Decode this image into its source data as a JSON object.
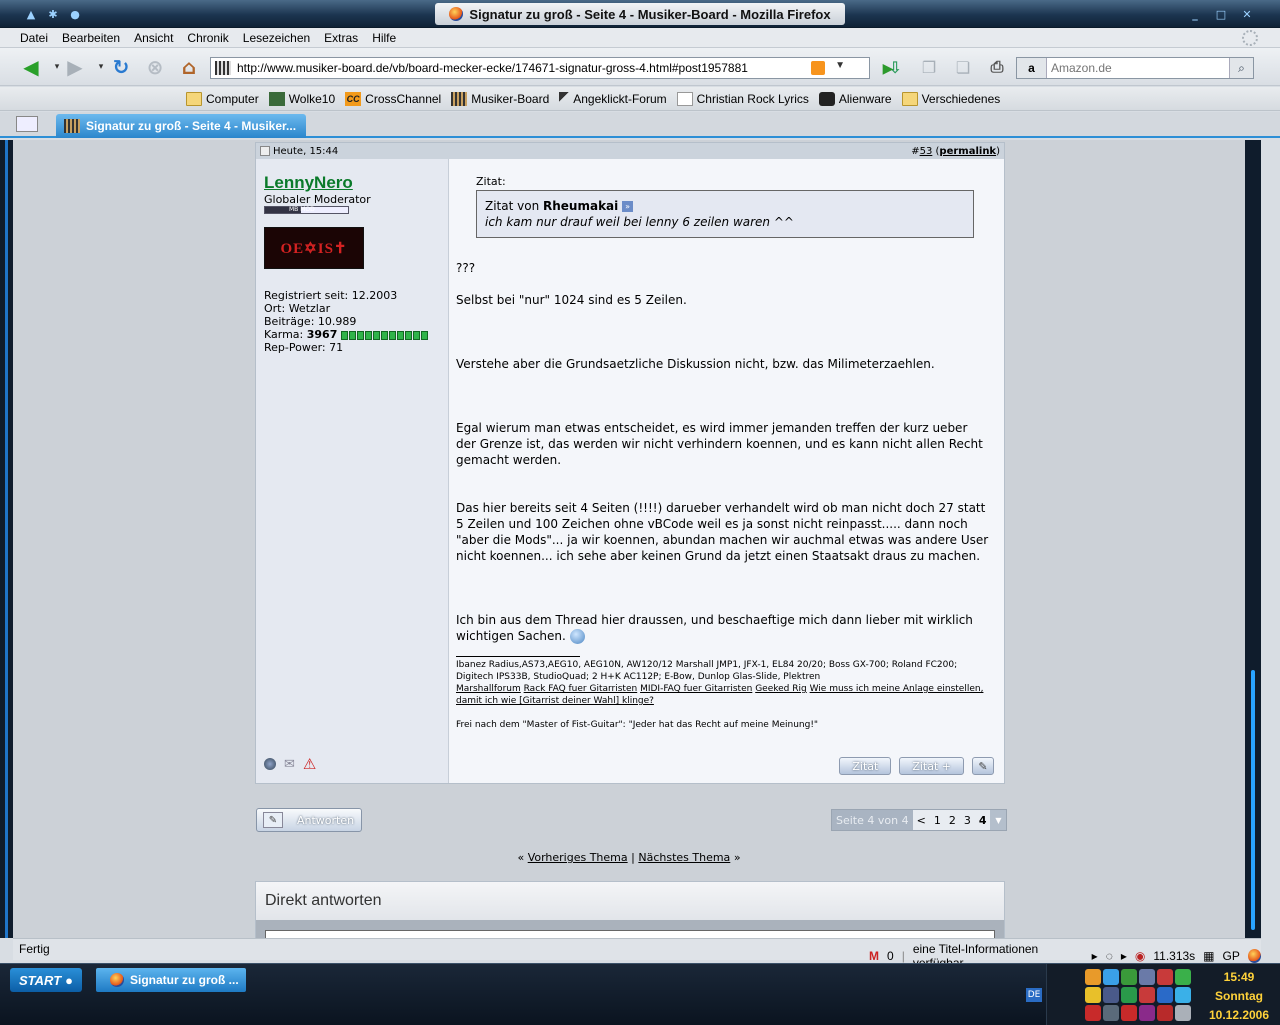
{
  "window": {
    "title": "Signatur zu groß - Seite 4 - Musiker-Board - Mozilla Firefox",
    "controls": [
      "_",
      "□",
      "✕"
    ]
  },
  "menu": [
    "Datei",
    "Bearbeiten",
    "Ansicht",
    "Chronik",
    "Lesezeichen",
    "Extras",
    "Hilfe"
  ],
  "nav": {
    "url": "http://www.musiker-board.de/vb/board-mecker-ecke/174671-signatur-gross-4.html#post1957881",
    "search_placeholder": "Amazon.de",
    "search_engine_icon": "a"
  },
  "bookmarks": [
    {
      "label": "Computer",
      "icon": "folder-icon"
    },
    {
      "label": "Wolke10",
      "icon": "wolke-icon"
    },
    {
      "label": "CrossChannel",
      "icon": "cc-icon"
    },
    {
      "label": "Musiker-Board",
      "icon": "musikerboard-icon"
    },
    {
      "label": "Angeklickt-Forum",
      "icon": "cursor-icon"
    },
    {
      "label": "Christian Rock Lyrics",
      "icon": "page-icon"
    },
    {
      "label": "Alienware",
      "icon": "alien-icon"
    },
    {
      "label": "Verschiedenes",
      "icon": "folder-icon"
    }
  ],
  "tab": {
    "label": "Signatur zu groß - Seite 4 - Musiker..."
  },
  "post": {
    "date": "Heute, 15:44",
    "number_prefix": "#",
    "number": "53",
    "permalink": "permalink",
    "user": {
      "name": "LennyNero",
      "title": "Globaler Moderator",
      "badge": "MB MOD",
      "avatar_text": "OE✡IS✝",
      "registered": "Registriert seit: 12.2003",
      "location": "Ort: Wetzlar",
      "posts": "Beiträge: 10.989",
      "karma_label": "Karma: ",
      "karma_value": "3967",
      "karma_level": 11,
      "rep": "Rep-Power: 71"
    },
    "quote": {
      "label": "Zitat:",
      "intro": "Zitat von ",
      "author": "Rheumakai",
      "text": "ich kam nur drauf weil bei lenny 6 zeilen waren ^^"
    },
    "paragraphs": [
      "???",
      "Selbst bei \"nur\" 1024 sind es 5 Zeilen.",
      "Verstehe aber die Grundsaetzliche Diskussion nicht, bzw. das Milimeterzaehlen.",
      "Egal wierum man etwas entscheidet, es wird immer jemanden treffen der kurz ueber der Grenze ist, das werden wir nicht verhindern koennen, und es kann nicht allen Recht gemacht werden.",
      "Das hier bereits seit 4 Seiten (!!!!) darueber verhandelt wird ob man nicht doch 27 statt 5 Zeilen und 100 Zeichen ohne vBCode weil es ja sonst nicht reinpasst..... dann noch \"aber die Mods\"... ja wir koennen, abundan machen wir auchmal etwas was andere User nicht koennen... ich sehe aber keinen Grund da jetzt einen Staatsakt draus zu machen.",
      "Ich bin aus dem Thread hier draussen, und beschaeftige mich dann lieber mit wirklich wichtigen Sachen."
    ],
    "signature": {
      "gear1": "Ibanez Radius,AS73,AEG10, AEG10N, AW120/12 Marshall JMP1, JFX-1, EL84 20/20; Boss GX-700; Roland FC200;",
      "gear2": "Digitech IPS33B, StudioQuad; 2 H+K AC112P; E-Bow, Dunlop Glas-Slide, Plektren",
      "links": [
        "Marshallforum",
        "Rack FAQ fuer Gitarristen",
        "MIDI-FAQ fuer Gitarristen",
        "Geeked Rig",
        "Wie muss ich meine Anlage einstellen, damit ich wie [Gitarrist deiner Wahl] klinge?"
      ],
      "motto": "Frei nach dem \"Master of Fist-Guitar\": \"Jeder hat das Recht auf meine Meinung!\""
    },
    "buttons": {
      "quote": "Zitat",
      "quote_plus": "Zitat +"
    }
  },
  "reply_button": "Antworten",
  "pager": {
    "label": "Seite 4 von 4",
    "prev": "<",
    "pages": [
      "1",
      "2",
      "3"
    ],
    "current": "4"
  },
  "thread_nav": {
    "open": "«",
    "prev": "Vorheriges Thema",
    "sep": "|",
    "next": "Nächstes Thema",
    "close": "»"
  },
  "quick_reply": {
    "title": "Direkt antworten"
  },
  "statusbar": {
    "left": "Fertig",
    "mail_count": "0",
    "info": "eine Titel-Informationen verfügbar.",
    "timer": "11.313s",
    "gp": "GP"
  },
  "taskbar": {
    "start": "START",
    "item": "Signatur zu groß ...",
    "lang": "DE",
    "time": "15:49",
    "day": "Sonntag",
    "date": "10.12.2006"
  },
  "colors": {
    "accent": "#2d8fd6",
    "username": "#0a7a2a",
    "clock": "#ffd23a"
  }
}
